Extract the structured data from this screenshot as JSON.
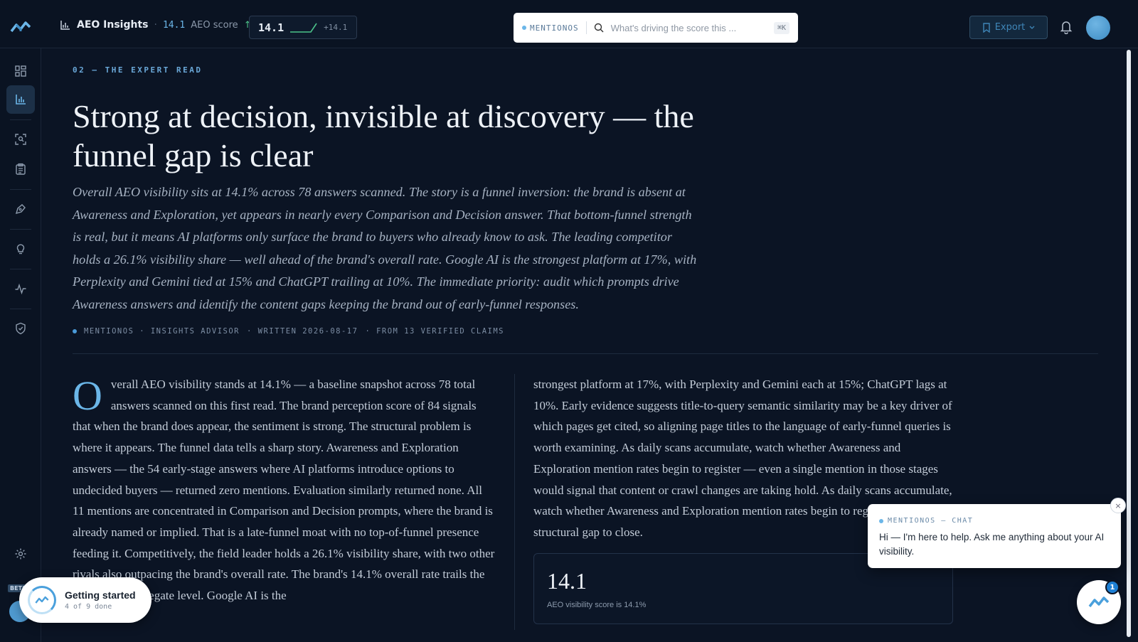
{
  "header": {
    "app_name": "AEO Insights",
    "score_value": "14.1",
    "score_label": "AEO score",
    "score_trend_glyph": "↑",
    "chip_score": "14.1",
    "chip_delta": "+14.1",
    "search_tag": "MENTIONOS",
    "search_placeholder": "What's driving the score this ...",
    "search_shortcut": "⌘K",
    "export_label": "Export"
  },
  "sidebar": {
    "items": [
      {
        "icon": "grid-icon"
      },
      {
        "icon": "bar-chart-icon",
        "active": true
      },
      {
        "icon": "scan-face-icon"
      },
      {
        "icon": "clipboard-icon"
      },
      {
        "icon": "pen-tool-icon"
      },
      {
        "icon": "lightbulb-icon"
      },
      {
        "icon": "activity-icon"
      },
      {
        "icon": "shield-check-icon"
      },
      {
        "icon": "settings-icon"
      }
    ],
    "beta_label": "BETA"
  },
  "article": {
    "eyebrow": "02 — THE EXPERT READ",
    "headline": "Strong at decision, invisible at discovery — the funnel gap is clear",
    "lede": "Overall AEO visibility sits at 14.1% across 78 answers scanned. The story is a funnel inversion: the brand is absent at Awareness and Exploration, yet appears in nearly every Comparison and Decision answer. That bottom-funnel strength is real, but it means AI platforms only surface the brand to buyers who already know to ask. The leading competitor holds a 26.1% visibility share — well ahead of the brand's overall rate. Google AI is the strongest platform at 17%, with Perplexity and Gemini tied at 15% and ChatGPT trailing at 10%. The immediate priority: audit which prompts drive Awareness answers and identify the content gaps keeping the brand out of early-funnel responses.",
    "byline_author": "MENTIONOS · INSIGHTS ADVISOR",
    "byline_written": "· WRITTEN 2026-08-17",
    "byline_claims": "· FROM 13 VERIFIED CLAIMS",
    "dropcap": "O",
    "col1_text": "verall AEO visibility stands at 14.1% — a baseline snapshot across 78 total answers scanned on this first read. The brand perception score of 84 signals that when the brand does appear, the sentiment is strong. The structural problem is where it appears. The funnel data tells a sharp story. Awareness and Exploration answers — the 54 early-stage answers where AI platforms introduce options to undecided buyers — returned zero mentions. Evaluation similarly returned none. All 11 mentions are concentrated in Comparison and Decision prompts, where the brand is already named or implied. That is a late-funnel moat with no top-of-funnel presence feeding it. Competitively, the field leader holds a 26.1% visibility share, with two other rivals also outpacing the brand's overall rate. The brand's 14.1% overall rate trails the field at the aggregate level. Google AI is the",
    "col2_text": "strongest platform at 17%, with Perplexity and Gemini each at 15%; ChatGPT lags at 10%. Early evidence suggests title-to-query semantic similarity may be a key driver of which pages get cited, so aligning page titles to the language of early-funnel queries is worth examining. As daily scans accumulate, watch whether Awareness and Exploration mention rates begin to register — even a single mention in those stages would signal that content or crawl changes are taking hold. As daily scans accumulate, watch whether Awareness and Exploration mention rates begin to register — that is the structural gap to close.",
    "stat_value": "14.1",
    "stat_caption": "AEO visibility score is 14.1%"
  },
  "chat": {
    "label": "MENTIONOS — CHAT",
    "message": "Hi — I'm here to help. Ask me anything about your AI visibility.",
    "close_glyph": "×",
    "badge_count": "1"
  },
  "getting_started": {
    "title": "Getting started",
    "progress": "4 of 9 done",
    "done": 4,
    "total": 9
  },
  "colors": {
    "accent": "#6bb6e8",
    "background": "#0b1424",
    "success": "#4cc38a"
  }
}
